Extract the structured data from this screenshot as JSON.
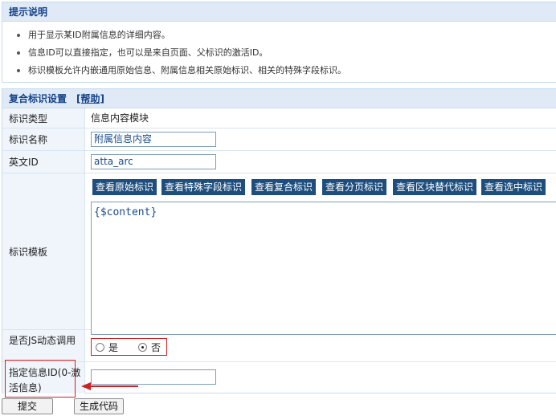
{
  "tips": {
    "title": "提示说明",
    "items": [
      "用于显示某ID附属信息的详细内容。",
      "信息ID可以直接指定，也可以是来自页面、父标识的激活ID。",
      "标识模板允许内嵌通用原始信息、附属信息相关原始标识、相关的特殊字段标识。"
    ]
  },
  "form": {
    "title": "复合标识设置",
    "help_link": "[帮助]",
    "tag_type": {
      "label": "标识类型",
      "value": "信息内容模块"
    },
    "tag_name": {
      "label": "标识名称",
      "value": "附属信息内容"
    },
    "english_id": {
      "label": "英文ID",
      "value": "atta_arc"
    },
    "template": {
      "label": "标识模板",
      "buttons": [
        "查看原始标识",
        "查看特殊字段标识",
        "查看复合标识",
        "查看分页标识",
        "查看区块替代标识",
        "查看选中标识"
      ],
      "content": "{$content}"
    },
    "js_dynamic": {
      "label": "是否JS动态调用",
      "options": [
        {
          "label": "是",
          "checked": false
        },
        {
          "label": "否",
          "checked": true
        }
      ]
    },
    "info_id": {
      "label": "指定信息ID(0-激活信息)",
      "value": ""
    }
  },
  "actions": {
    "submit": "提交",
    "generate": "生成代码"
  },
  "colors": {
    "highlight": "#d02020",
    "header_bg": "#dfeaf6",
    "button_bg": "#1d4e7e"
  }
}
